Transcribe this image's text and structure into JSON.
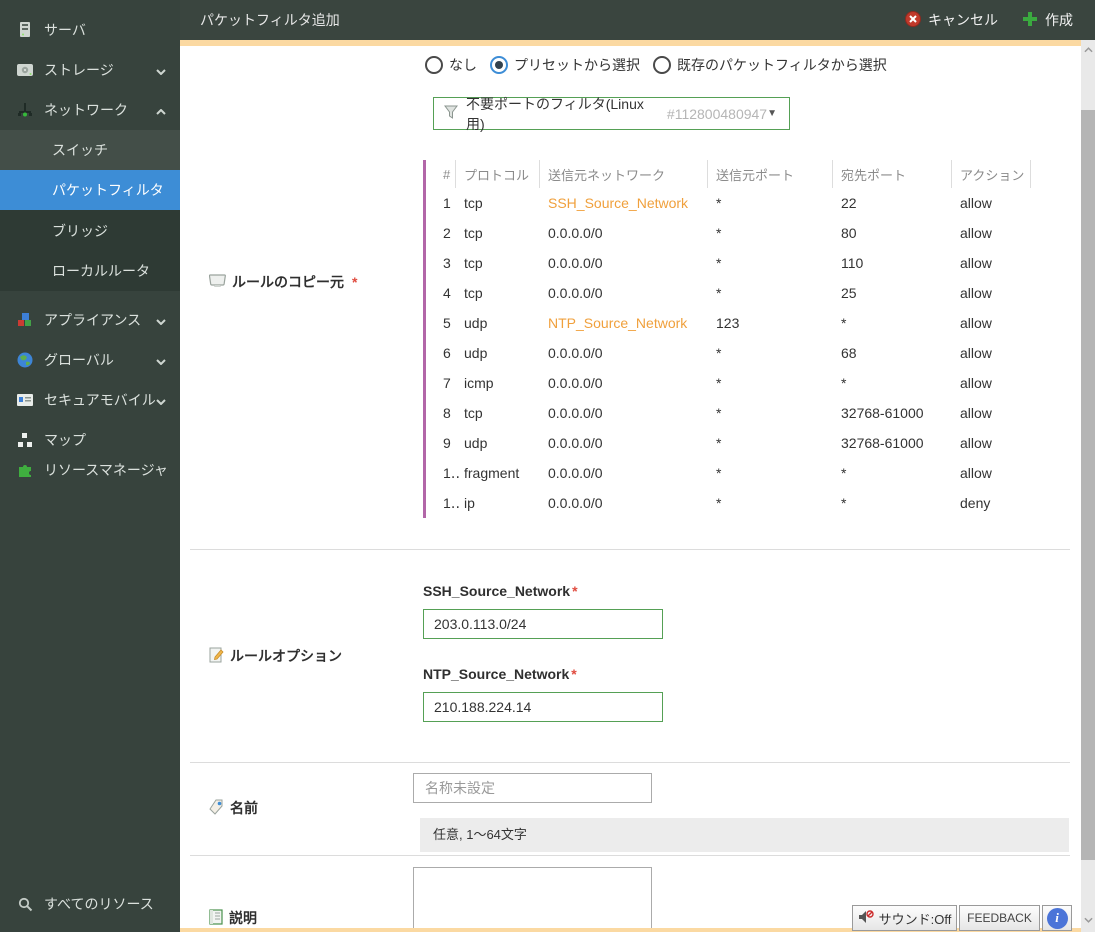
{
  "header": {
    "title": "パケットフィルタ追加",
    "cancel_label": "キャンセル",
    "create_label": "作成"
  },
  "sidebar": {
    "server": "サーバ",
    "storage": "ストレージ",
    "network": "ネットワーク",
    "switch": "スイッチ",
    "packet_filter": "パケットフィルタ",
    "bridge": "ブリッジ",
    "local_router": "ローカルルータ",
    "appliance": "アプライアンス",
    "global": "グローバル",
    "secure_mobile": "セキュアモバイル",
    "map": "マップ",
    "resource_manager": "リソースマネージャ",
    "all_resources": "すべてのリソース"
  },
  "form": {
    "copy_source": {
      "label": "ルールのコピー元",
      "required": "*",
      "radio_none": "なし",
      "radio_preset": "プリセットから選択",
      "radio_existing": "既存のパケットフィルタから選択",
      "preset_select": {
        "icon": "filter-icon",
        "value": "不要ポートのフィルタ(Linux用)",
        "id": "#112800480947",
        "caret": "▼"
      },
      "table": {
        "headers": [
          "#",
          "プロトコル",
          "送信元ネットワーク",
          "送信元ポート",
          "宛先ポート",
          "アクション"
        ],
        "rows": [
          {
            "num": "1",
            "protocol": "tcp",
            "src_network": "SSH_Source_Network",
            "src_net_link": true,
            "src_port": "*",
            "dst_port": "22",
            "action": "allow"
          },
          {
            "num": "2",
            "protocol": "tcp",
            "src_network": "0.0.0.0/0",
            "src_net_link": false,
            "src_port": "*",
            "dst_port": "80",
            "action": "allow"
          },
          {
            "num": "3",
            "protocol": "tcp",
            "src_network": "0.0.0.0/0",
            "src_net_link": false,
            "src_port": "*",
            "dst_port": "110",
            "action": "allow"
          },
          {
            "num": "4",
            "protocol": "tcp",
            "src_network": "0.0.0.0/0",
            "src_net_link": false,
            "src_port": "*",
            "dst_port": "25",
            "action": "allow"
          },
          {
            "num": "5",
            "protocol": "udp",
            "src_network": "NTP_Source_Network",
            "src_net_link": true,
            "src_port": "123",
            "dst_port": "*",
            "action": "allow"
          },
          {
            "num": "6",
            "protocol": "udp",
            "src_network": "0.0.0.0/0",
            "src_net_link": false,
            "src_port": "*",
            "dst_port": "68",
            "action": "allow"
          },
          {
            "num": "7",
            "protocol": "icmp",
            "src_network": "0.0.0.0/0",
            "src_net_link": false,
            "src_port": "*",
            "dst_port": "*",
            "action": "allow"
          },
          {
            "num": "8",
            "protocol": "tcp",
            "src_network": "0.0.0.0/0",
            "src_net_link": false,
            "src_port": "*",
            "dst_port": "32768-61000",
            "action": "allow"
          },
          {
            "num": "9",
            "protocol": "udp",
            "src_network": "0.0.0.0/0",
            "src_net_link": false,
            "src_port": "*",
            "dst_port": "32768-61000",
            "action": "allow"
          },
          {
            "num": "1‥",
            "protocol": "fragment",
            "src_network": "0.0.0.0/0",
            "src_net_link": false,
            "src_port": "*",
            "dst_port": "*",
            "action": "allow"
          },
          {
            "num": "1‥",
            "protocol": "ip",
            "src_network": "0.0.0.0/0",
            "src_net_link": false,
            "src_port": "*",
            "dst_port": "*",
            "action": "deny"
          }
        ]
      }
    },
    "rule_options": {
      "label": "ルールオプション",
      "fields": [
        {
          "label": "SSH_Source_Network",
          "required": "*",
          "value": "203.0.113.0/24"
        },
        {
          "label": "NTP_Source_Network",
          "required": "*",
          "value": "210.188.224.14"
        }
      ]
    },
    "name": {
      "label": "名前",
      "placeholder": "名称未設定",
      "hint": "任意, 1〜64文字"
    },
    "description": {
      "label": "説明"
    }
  },
  "footer_widgets": {
    "sound": "サウンド:Off",
    "feedback": "FEEDBACK",
    "info": "i"
  },
  "colors": {
    "sidebar_bg": "#37433d",
    "submenu_bg": "#2e3a34",
    "active_item_blue": "#3d8dd6",
    "header_bg": "#3a453f",
    "accent_purple_bar": "#b266a8",
    "link_orange": "#f0a03c",
    "strip_orange": "#fbd9a2",
    "input_green_border": "#55a055",
    "required_red": "#e04b3f",
    "cancel_red": "#c0392b",
    "create_green": "#3aa93f"
  }
}
